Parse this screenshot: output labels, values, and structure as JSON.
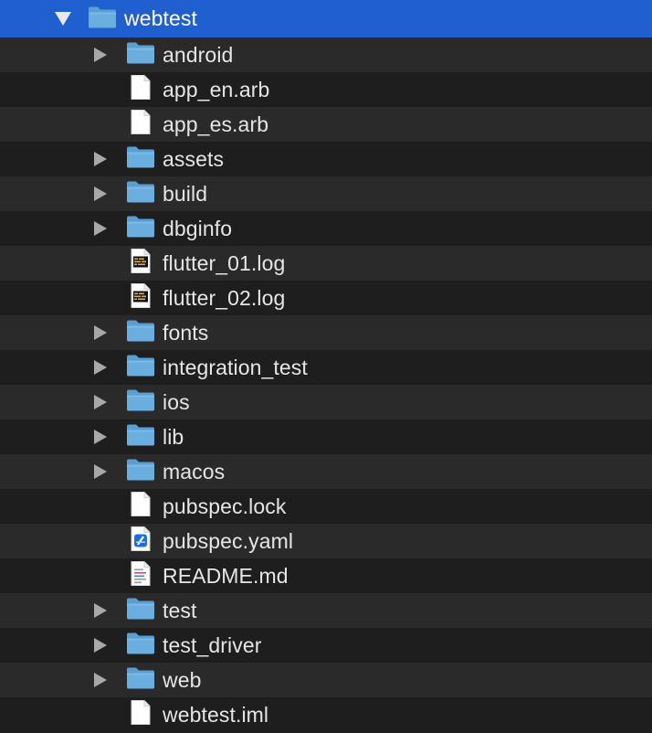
{
  "tree": {
    "root": {
      "name": "webtest",
      "kind": "folder",
      "expanded": true,
      "selected": true
    },
    "children": [
      {
        "name": "android",
        "kind": "folder"
      },
      {
        "name": "app_en.arb",
        "kind": "file"
      },
      {
        "name": "app_es.arb",
        "kind": "file"
      },
      {
        "name": "assets",
        "kind": "folder"
      },
      {
        "name": "build",
        "kind": "folder"
      },
      {
        "name": "dbginfo",
        "kind": "folder"
      },
      {
        "name": "flutter_01.log",
        "kind": "log"
      },
      {
        "name": "flutter_02.log",
        "kind": "log"
      },
      {
        "name": "fonts",
        "kind": "folder"
      },
      {
        "name": "integration_test",
        "kind": "folder"
      },
      {
        "name": "ios",
        "kind": "folder"
      },
      {
        "name": "lib",
        "kind": "folder"
      },
      {
        "name": "macos",
        "kind": "folder"
      },
      {
        "name": "pubspec.lock",
        "kind": "file"
      },
      {
        "name": "pubspec.yaml",
        "kind": "yaml"
      },
      {
        "name": "README.md",
        "kind": "markdown"
      },
      {
        "name": "test",
        "kind": "folder"
      },
      {
        "name": "test_driver",
        "kind": "folder"
      },
      {
        "name": "web",
        "kind": "folder"
      },
      {
        "name": "webtest.iml",
        "kind": "file"
      }
    ]
  },
  "colors": {
    "selection": "#1f5fcf",
    "folder": "#6aaee0",
    "text": "#e6e6e6",
    "row_alt": "#2a2a2a",
    "background": "#1e1e1e"
  },
  "icons": {
    "folder": "folder-icon",
    "file": "document-icon",
    "log": "log-file-icon",
    "yaml": "xcode-file-icon",
    "markdown": "markdown-file-icon"
  }
}
